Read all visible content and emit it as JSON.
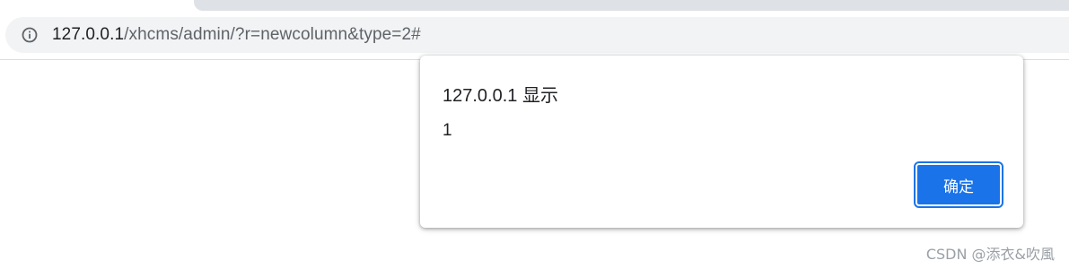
{
  "browser": {
    "address_bar": {
      "host": "127.0.0.1",
      "path": "/xhcms/admin/?r=newcolumn&type=2#",
      "site_info_icon": "info-icon"
    }
  },
  "dialog": {
    "title": "127.0.0.1 显示",
    "message": "1",
    "ok_label": "确定",
    "accent_color": "#1a73e8"
  },
  "watermark": {
    "text": "CSDN @添衣&吹風"
  }
}
